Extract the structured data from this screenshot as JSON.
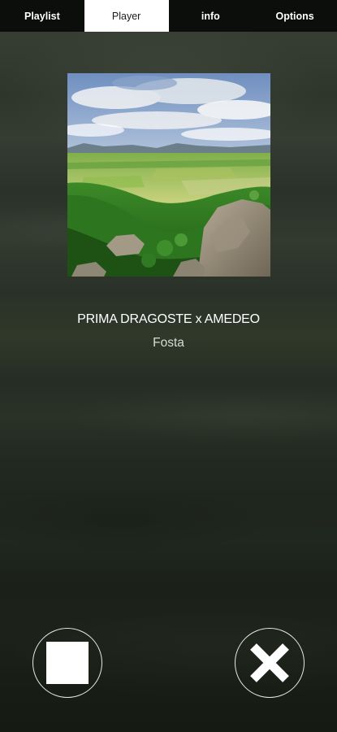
{
  "tabs": [
    {
      "label": "Playlist",
      "active": false
    },
    {
      "label": "Player",
      "active": true
    },
    {
      "label": "info",
      "active": false
    },
    {
      "label": "Options",
      "active": false
    }
  ],
  "album_art": {
    "icon": "landscape-cover-art"
  },
  "track": {
    "title": "PRIMA DRAGOSTE x AMEDEO",
    "artist": "Fosta"
  },
  "controls": {
    "stop_icon": "stop-icon",
    "close_icon": "close-icon"
  },
  "colors": {
    "tabbar_bg": "#0b0e0a",
    "active_tab_bg": "#ffffff",
    "text_primary": "#ffffff",
    "background": "#2a3128"
  }
}
